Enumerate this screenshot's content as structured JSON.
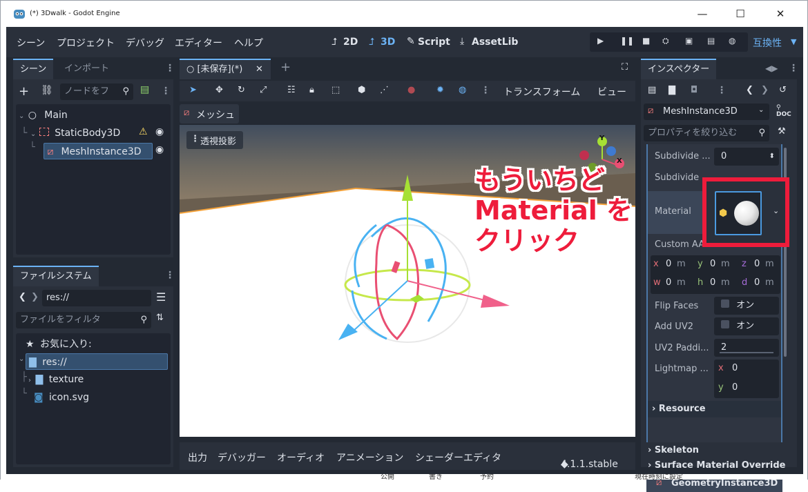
{
  "window": {
    "title": "(*) 3Dwalk - Godot Engine",
    "minimize": "—",
    "maximize": "☐",
    "close": "✕"
  },
  "menu": {
    "items": [
      "シーン",
      "プロジェクト",
      "デバッグ",
      "エディター",
      "ヘルプ"
    ]
  },
  "modes": {
    "d2": "2D",
    "d3": "3D",
    "script": "Script",
    "assetlib": "AssetLib"
  },
  "renderer": "互換性",
  "scene_dock": {
    "tabs": [
      "シーン",
      "インポート"
    ],
    "filter_placeholder": "ノードをフ",
    "nodes": [
      "Main",
      "StaticBody3D",
      "MeshInstance3D"
    ]
  },
  "filesystem_dock": {
    "tab": "ファイルシステム",
    "path": "res://",
    "filter_placeholder": "ファイルをフィルタ",
    "favorites": "お気に入り:",
    "items": [
      "res://",
      "texture",
      "icon.svg"
    ]
  },
  "editor": {
    "scene_tab": "[未保存](*)",
    "toolbar_right": [
      "トランスフォーム",
      "ビュー"
    ],
    "mesh_menu": "メッシュ",
    "perspective": "透視投影",
    "gizmo_axes": [
      "Y",
      "X"
    ]
  },
  "bottom_panel": {
    "tabs": [
      "出力",
      "デバッガー",
      "オーディオ",
      "アニメーション",
      "シェーダーエディタ"
    ],
    "version": "4.1.1.stable"
  },
  "inspector": {
    "tab": "インスペクター",
    "object": "MeshInstance3D",
    "filter_placeholder": "プロパティを絞り込む",
    "props": {
      "subdivide1_label": "Subdivide ...",
      "subdivide1_value": "0",
      "subdivide2_label": "Subdivide",
      "material_label": "Material",
      "custom_aabb_label": "Custom AA",
      "aabb": [
        {
          "axis": "x",
          "value": "0",
          "unit": "m"
        },
        {
          "axis": "y",
          "value": "0",
          "unit": "m"
        },
        {
          "axis": "z",
          "value": "0",
          "unit": "m"
        },
        {
          "axis": "w",
          "value": "0",
          "unit": "m"
        },
        {
          "axis": "h",
          "value": "0",
          "unit": "m"
        },
        {
          "axis": "d",
          "value": "0",
          "unit": "m"
        }
      ],
      "flip_faces_label": "Flip Faces",
      "flip_faces_value": "オン",
      "add_uv2_label": "Add UV2",
      "add_uv2_value": "オン",
      "uv2_padding_label": "UV2 Paddi...",
      "uv2_padding_value": "2",
      "lightmap_label": "Lightmap ...",
      "lightmap_x_axis": "x",
      "lightmap_x": "0",
      "lightmap_y_axis": "y",
      "lightmap_y": "0"
    },
    "sections": [
      "Resource",
      "Skeleton",
      "Surface Material Override",
      "GeometryInstance3D"
    ]
  },
  "annotation": {
    "line1": "もういちど",
    "line2": "Material を",
    "line3": "クリック",
    "color": "#ee1c3b"
  },
  "background_partial": {
    "left": "公開",
    "mid": "書き",
    "right": "予約",
    "far": "現在時刻に設定"
  }
}
